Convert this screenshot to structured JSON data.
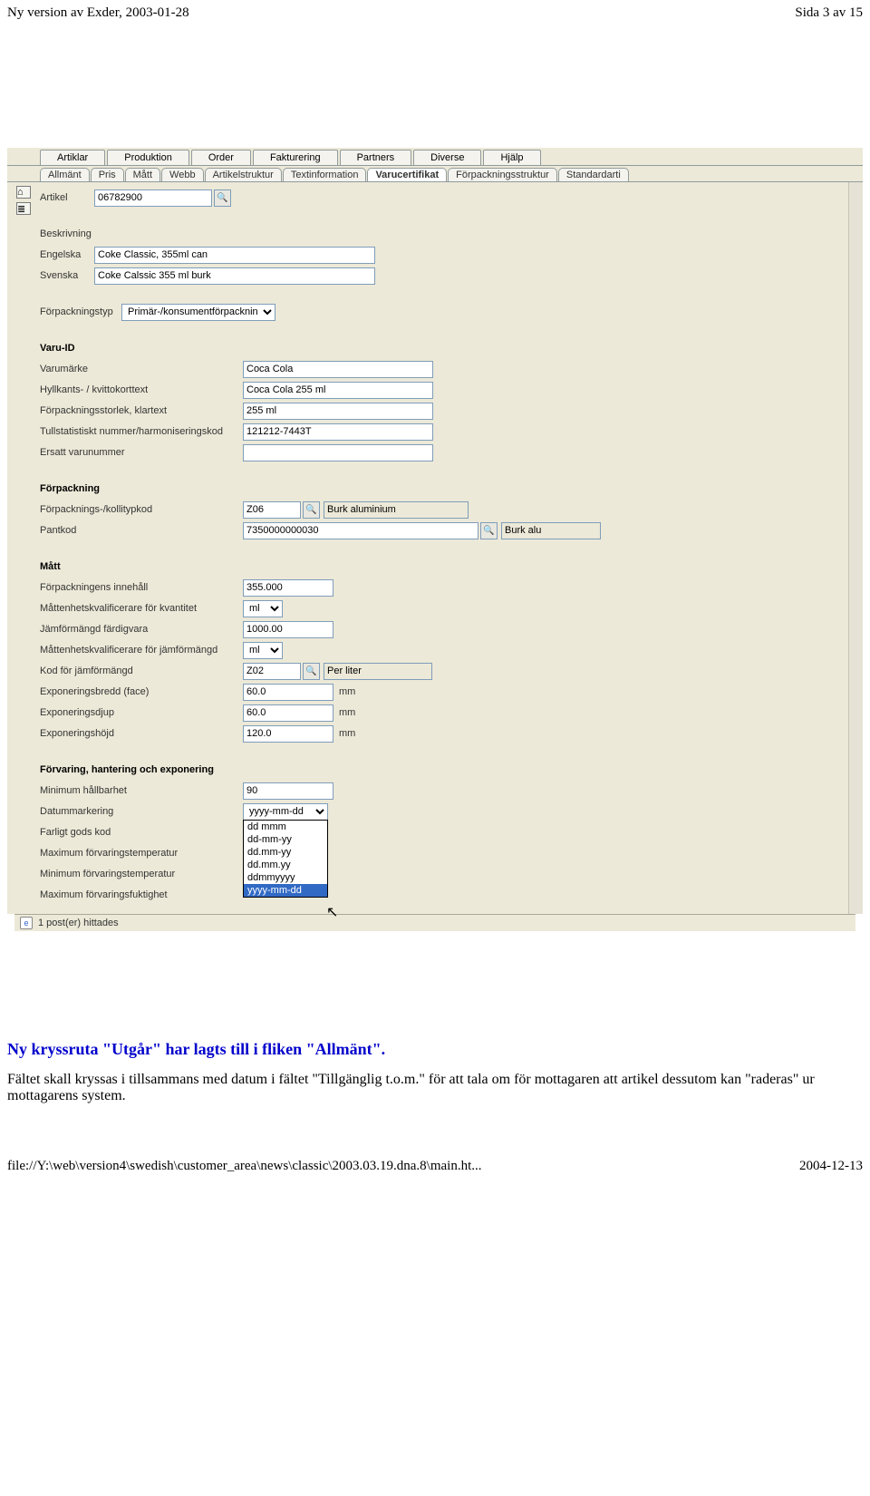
{
  "page": {
    "header_left": "Ny version av Exder, 2003-01-28",
    "header_right": "Sida 3 av 15"
  },
  "top_tabs": [
    "Artiklar",
    "Produktion",
    "Order",
    "Fakturering",
    "Partners",
    "Diverse",
    "Hjälp"
  ],
  "sub_tabs": [
    "Allmänt",
    "Pris",
    "Mått",
    "Webb",
    "Artikelstruktur",
    "Textinformation",
    "Varucertifikat",
    "Förpackningsstruktur",
    "Standardarti"
  ],
  "active_sub_tab": 6,
  "labels": {
    "artikel": "Artikel",
    "beskrivning": "Beskrivning",
    "engelska": "Engelska",
    "svenska": "Svenska",
    "forpackningstyp": "Förpackningstyp",
    "varu_id": "Varu-ID",
    "varumarke": "Varumärke",
    "hyllkant": "Hyllkants- / kvittokorttext",
    "forp_storlek": "Förpackningsstorlek, klartext",
    "tullstat": "Tullstatistiskt nummer/harmoniseringskod",
    "ersatt": "Ersatt varunummer",
    "forpackning": "Förpackning",
    "forp_kolli": "Förpacknings-/kollitypkod",
    "pantkod": "Pantkod",
    "matt": "Mått",
    "forp_innehall": "Förpackningens innehåll",
    "matt_kval_kvant": "Måttenhetskvalificerare för kvantitet",
    "jamfor_fardig": "Jämförmängd färdigvara",
    "matt_kval_jamfor": "Måttenhetskvalificerare för jämförmängd",
    "kod_jamfor": "Kod för jämförmängd",
    "expon_bredd": "Exponeringsbredd (face)",
    "expon_djup": "Exponeringsdjup",
    "expon_hojd": "Exponeringshöjd",
    "forvaring": "Förvaring, hantering och exponering",
    "min_hallbar": "Minimum hållbarhet",
    "datummark": "Datummarkering",
    "farligt_gods": "Farligt gods kod",
    "max_forv_temp": "Maximum förvaringstemperatur",
    "min_forv_temp": "Minimum förvaringstemperatur",
    "max_forv_fukt": "Maximum förvaringsfuktighet",
    "mm": "mm"
  },
  "values": {
    "artikel": "06782900",
    "desc_en": "Coke Classic, 355ml can",
    "desc_sv": "Coke Calssic 355 ml burk",
    "forpackningstyp": "Primär-/konsumentförpackning",
    "varumarke": "Coca Cola",
    "hyllkant": "Coca Cola 255 ml",
    "forp_storlek": "255 ml",
    "tullstat": "121212-7443T",
    "ersatt": "",
    "forp_kolli_code": "Z06",
    "forp_kolli_desc": "Burk aluminium",
    "pantkod": "7350000000030",
    "pantkod_desc": "Burk alu",
    "forp_innehall": "355.000",
    "unit_ml": "ml",
    "jamfor_fardig": "1000.00",
    "kod_jamfor_code": "Z02",
    "kod_jamfor_desc": "Per liter",
    "expon_bredd": "60.0",
    "expon_djup": "60.0",
    "expon_hojd": "120.0",
    "min_hallbar": "90",
    "datummark": "yyyy-mm-dd",
    "farligt_gods": "",
    "max_forv_temp": "",
    "min_forv_temp": "",
    "max_forv_fukt": ""
  },
  "date_options": [
    "dd mmm",
    "dd-mm-yy",
    "dd.mm-yy",
    "dd.mm.yy",
    "ddmmyyyy",
    "yyyy-mm-dd"
  ],
  "date_selected_index": 5,
  "status": "1 post(er) hittades",
  "footnote": {
    "title": "Ny kryssruta \"Utgår\" har lagts till i fliken \"Allmänt\".",
    "body": "Fältet skall kryssas i tillsammans med datum i fältet \"Tillgänglig t.o.m.\" för att tala om för mottagaren att artikel dessutom kan \"raderas\" ur mottagarens system."
  },
  "footer": {
    "left": "file://Y:\\web\\version4\\swedish\\customer_area\\news\\classic\\2003.03.19.dna.8\\main.ht...",
    "right": "2004-12-13"
  }
}
